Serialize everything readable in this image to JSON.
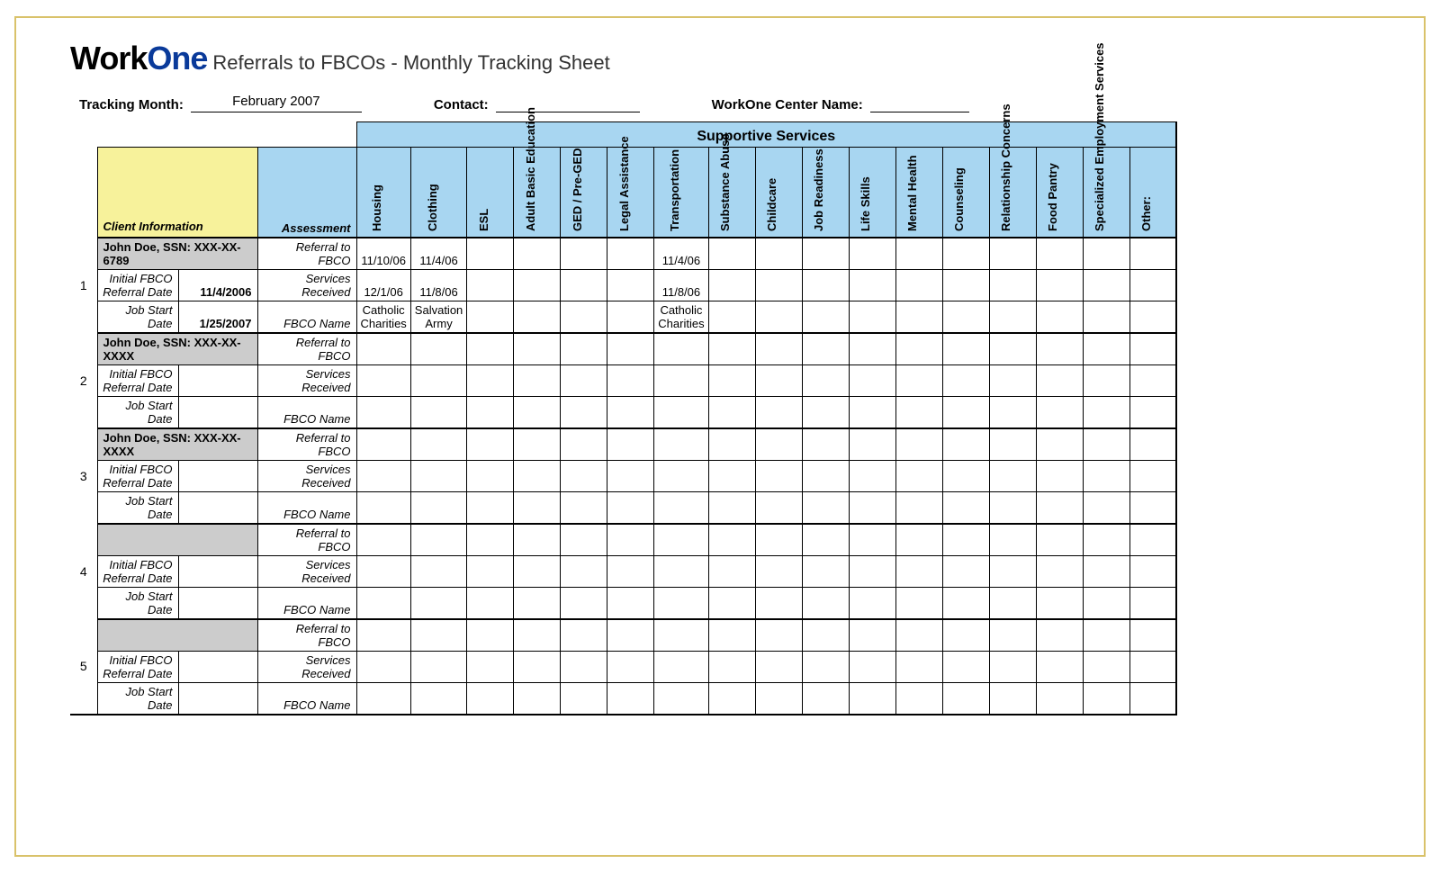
{
  "brand": {
    "part1": "Work",
    "part2": "One"
  },
  "title": "Referrals to FBCOs - Monthly Tracking Sheet",
  "meta": {
    "tracking_month_label": "Tracking Month:",
    "tracking_month_value": "February 2007",
    "contact_label": "Contact:",
    "contact_value": "",
    "center_label": "WorkOne Center Name:",
    "center_value": ""
  },
  "headers": {
    "client_info": "Client Information",
    "assessment": "Assessment",
    "supportive": "Supportive Services",
    "services": [
      "Housing",
      "Clothing",
      "ESL",
      "Adult Basic Education",
      "GED / Pre-GED",
      "Legal Assistance",
      "Transportation",
      "Substance Abuse",
      "Childcare",
      "Job Readiness",
      "Life Skills",
      "Mental Health",
      "Counseling",
      "Relationship Concerns",
      "Food Pantry",
      "Specialized Employment Services",
      "Other:"
    ]
  },
  "row_labels": {
    "initial": "Initial FBCO Referral Date",
    "jobstart": "Job Start Date",
    "referral": "Referral to FBCO",
    "received": "Services Received",
    "fbco": "FBCO Name"
  },
  "clients": [
    {
      "num": "1",
      "name": "John Doe, SSN: XXX-XX-6789",
      "initial_date": "11/4/2006",
      "jobstart_date": "1/25/2007",
      "referral": [
        "11/10/06",
        "11/4/06",
        "",
        "",
        "",
        "",
        "11/4/06",
        "",
        "",
        "",
        "",
        "",
        "",
        "",
        "",
        "",
        ""
      ],
      "received": [
        "12/1/06",
        "11/8/06",
        "",
        "",
        "",
        "",
        "11/8/06",
        "",
        "",
        "",
        "",
        "",
        "",
        "",
        "",
        "",
        ""
      ],
      "fbco": [
        "Catholic Charities",
        "Salvation Army",
        "",
        "",
        "",
        "",
        "Catholic Charities",
        "",
        "",
        "",
        "",
        "",
        "",
        "",
        "",
        "",
        ""
      ]
    },
    {
      "num": "2",
      "name": "John Doe, SSN: XXX-XX-XXXX",
      "initial_date": "",
      "jobstart_date": "",
      "referral": [
        "",
        "",
        "",
        "",
        "",
        "",
        "",
        "",
        "",
        "",
        "",
        "",
        "",
        "",
        "",
        "",
        ""
      ],
      "received": [
        "",
        "",
        "",
        "",
        "",
        "",
        "",
        "",
        "",
        "",
        "",
        "",
        "",
        "",
        "",
        "",
        ""
      ],
      "fbco": [
        "",
        "",
        "",
        "",
        "",
        "",
        "",
        "",
        "",
        "",
        "",
        "",
        "",
        "",
        "",
        "",
        ""
      ]
    },
    {
      "num": "3",
      "name": "John Doe, SSN: XXX-XX-XXXX",
      "initial_date": "",
      "jobstart_date": "",
      "referral": [
        "",
        "",
        "",
        "",
        "",
        "",
        "",
        "",
        "",
        "",
        "",
        "",
        "",
        "",
        "",
        "",
        ""
      ],
      "received": [
        "",
        "",
        "",
        "",
        "",
        "",
        "",
        "",
        "",
        "",
        "",
        "",
        "",
        "",
        "",
        "",
        ""
      ],
      "fbco": [
        "",
        "",
        "",
        "",
        "",
        "",
        "",
        "",
        "",
        "",
        "",
        "",
        "",
        "",
        "",
        "",
        ""
      ]
    },
    {
      "num": "4",
      "name": "",
      "initial_date": "",
      "jobstart_date": "",
      "referral": [
        "",
        "",
        "",
        "",
        "",
        "",
        "",
        "",
        "",
        "",
        "",
        "",
        "",
        "",
        "",
        "",
        ""
      ],
      "received": [
        "",
        "",
        "",
        "",
        "",
        "",
        "",
        "",
        "",
        "",
        "",
        "",
        "",
        "",
        "",
        "",
        ""
      ],
      "fbco": [
        "",
        "",
        "",
        "",
        "",
        "",
        "",
        "",
        "",
        "",
        "",
        "",
        "",
        "",
        "",
        "",
        ""
      ]
    },
    {
      "num": "5",
      "name": "",
      "initial_date": "",
      "jobstart_date": "",
      "referral": [
        "",
        "",
        "",
        "",
        "",
        "",
        "",
        "",
        "",
        "",
        "",
        "",
        "",
        "",
        "",
        "",
        ""
      ],
      "received": [
        "",
        "",
        "",
        "",
        "",
        "",
        "",
        "",
        "",
        "",
        "",
        "",
        "",
        "",
        "",
        "",
        ""
      ],
      "fbco": [
        "",
        "",
        "",
        "",
        "",
        "",
        "",
        "",
        "",
        "",
        "",
        "",
        "",
        "",
        "",
        "",
        ""
      ]
    }
  ]
}
